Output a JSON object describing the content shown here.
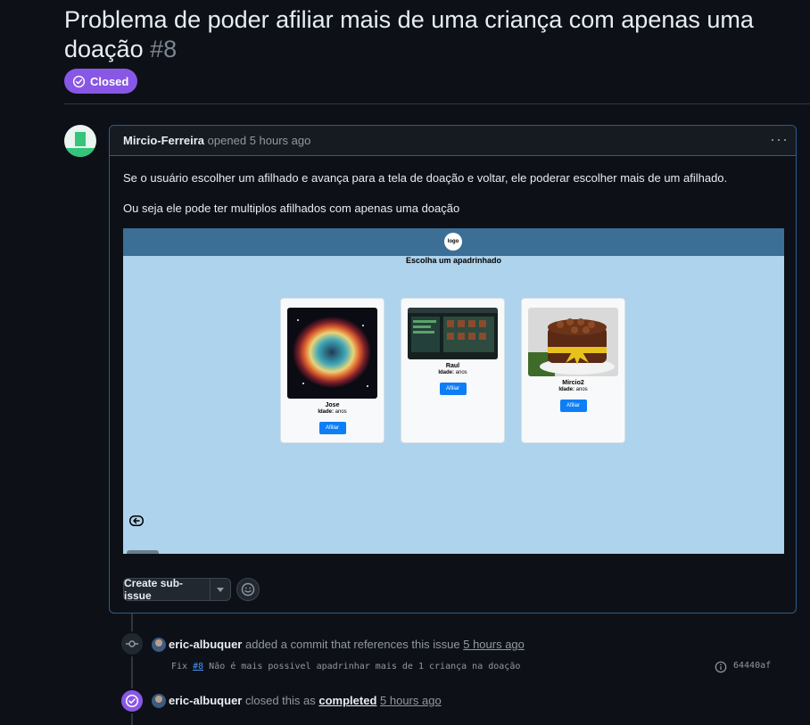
{
  "issue": {
    "title": "Problema de poder afiliar mais de uma criança com apenas uma doação",
    "number": "#8",
    "state": "Closed"
  },
  "comment": {
    "author": "Mircio-Ferreira",
    "action": "opened",
    "time": "5 hours ago",
    "paragraph1": "Se o usuário escolher um afilhado e avança para a tela de doação e voltar, ele poderar escolher mais de um afilhado.",
    "paragraph2": "Ou seja ele pode ter multiplos afilhados com apenas uma doação"
  },
  "embedded_screenshot": {
    "logo": "logo",
    "heading": "Escolha um apadrinhado",
    "age_label": "Idade:",
    "age_unit": "anos",
    "button_label": "Afiliar",
    "cards": [
      {
        "name": "Jose"
      },
      {
        "name": "Raul"
      },
      {
        "name": "Mircio2"
      }
    ]
  },
  "actions": {
    "create_sub_issue": "Create sub-issue"
  },
  "timeline": {
    "commit_event": {
      "user": "eric-albuquer",
      "text": "added a commit that references this issue",
      "time": "5 hours ago",
      "commit_prefix": "Fix",
      "commit_ref": "#8",
      "commit_message": "Não é mais possivel apadrinhar mais de 1 criança na doação",
      "sha": "64440af"
    },
    "closed_event": {
      "user": "eric-albuquer",
      "text": "closed this as",
      "reason": "completed",
      "time": "5 hours ago"
    }
  },
  "colors": {
    "background": "#0d1117",
    "closed_purple": "#8957e5",
    "comment_border": "#2f5a8c",
    "link_blue": "#4493f8"
  }
}
